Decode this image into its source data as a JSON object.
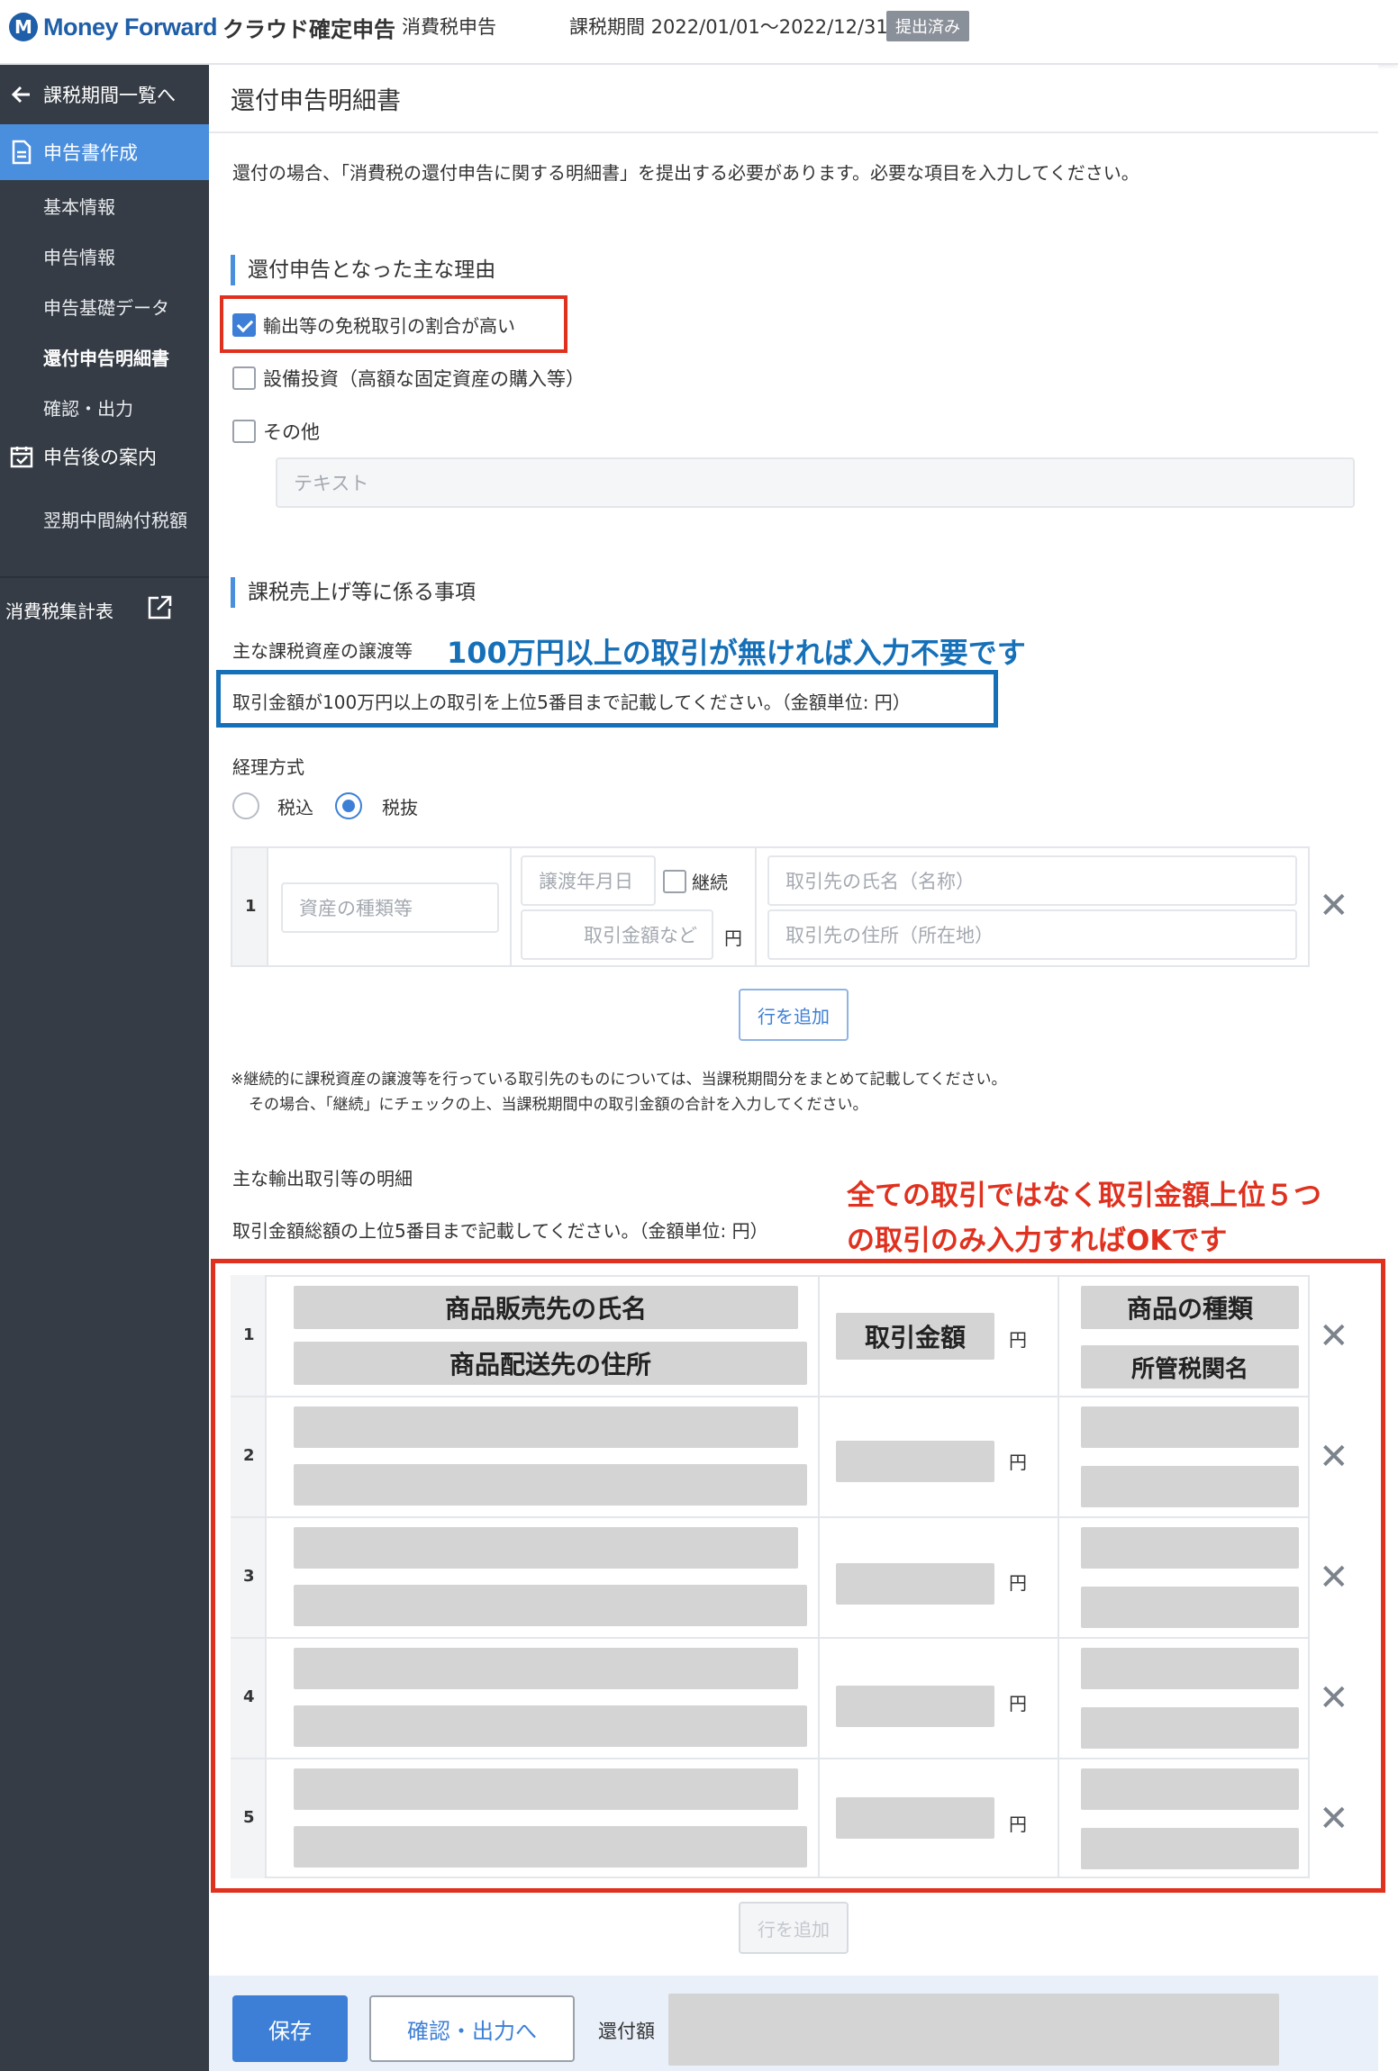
{
  "header": {
    "brand": "Money Forward",
    "product": "クラウド確定申告",
    "module": "消費税申告",
    "period": "課税期間 2022/01/01〜2022/12/31",
    "status_badge": "提出済み"
  },
  "sidebar": {
    "back": "課税期間一覧へ",
    "section_create": "申告書作成",
    "sub_items": [
      "基本情報",
      "申告情報",
      "申告基礎データ",
      "還付申告明細書",
      "確認・出力"
    ],
    "section_after": "申告後の案内",
    "after_items": [
      "翌期中間納付税額"
    ],
    "summary": "消費税集計表"
  },
  "page": {
    "title": "還付申告明細書",
    "intro": "還付の場合、「消費税の還付申告に関する明細書」を提出する必要があります。必要な項目を入力してください。"
  },
  "reasons": {
    "title": "還付申告となった主な理由",
    "options": [
      {
        "label": "輸出等の免税取引の割合が高い",
        "checked": true
      },
      {
        "label": "設備投資（高額な固定資産の購入等）",
        "checked": false
      },
      {
        "label": "その他",
        "checked": false
      }
    ],
    "text_placeholder": "テキスト"
  },
  "sales": {
    "title": "課税売上げ等に係る事項",
    "subtitle": "主な課税資産の譲渡等",
    "annotation": "100万円以上の取引が無ければ入力不要です",
    "instruction": "取引金額が100万円以上の取引を上位5番目まで記載してください。（金額単位: 円）",
    "accounting_label": "経理方式",
    "accounting_options": [
      "税込",
      "税抜"
    ],
    "accounting_selected": "税抜",
    "row_number": "1",
    "asset_placeholder": "資産の種類等",
    "date_placeholder": "譲渡年月日",
    "continue_label": "継続",
    "amount_placeholder": "取引金額など",
    "yen": "円",
    "partner_name_placeholder": "取引先の氏名（名称）",
    "partner_address_placeholder": "取引先の住所（所在地）",
    "add_row": "行を追加",
    "note_line1": "※継続的に課税資産の譲渡等を行っている取引先のものについては、当課税期間分をまとめて記載してください。",
    "note_line2": "その場合、「継続」にチェックの上、当課税期間中の取引金額の合計を入力してください。"
  },
  "exports": {
    "subtitle": "主な輸出取引等の明細",
    "instruction": "取引金額総額の上位5番目まで記載してください。（金額単位: 円）",
    "annotation_line1": "全ての取引ではなく取引金額上位５つ",
    "annotation_line2": "の取引のみ入力すればOKです",
    "col_name": "商品販売先の氏名",
    "col_address": "商品配送先の住所",
    "col_amount": "取引金額",
    "col_type": "商品の種類",
    "col_customs": "所管税関名",
    "rows": [
      "1",
      "2",
      "3",
      "4",
      "5"
    ],
    "yen": "円",
    "add_row": "行を追加"
  },
  "footer": {
    "save": "保存",
    "confirm": "確認・出力へ",
    "refund_label": "還付額"
  },
  "colors": {
    "sidebar": "#353c45",
    "accent": "#4a8ede",
    "annotation_red": "#e0311f",
    "annotation_blue": "#1670b8"
  }
}
